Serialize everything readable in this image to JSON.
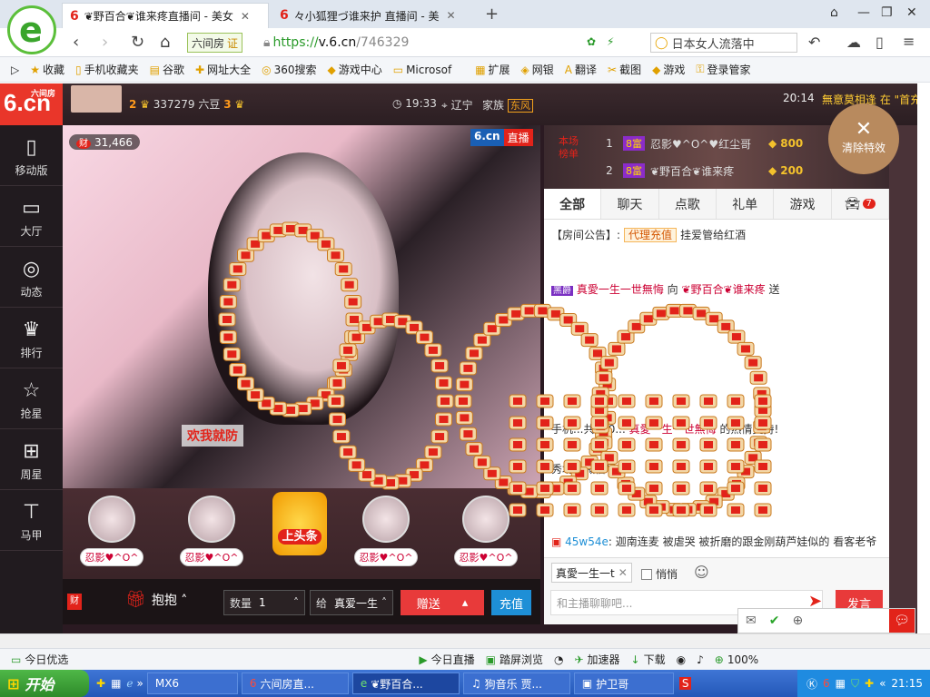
{
  "browser": {
    "tabs": [
      {
        "title": "❦野百合❦谁来疼直播间 - 美女",
        "active": true
      },
      {
        "title": "々小狐狸づ谁来护  直播间 - 美",
        "active": false
      }
    ],
    "new_tab": "+",
    "site_chip": "六间房",
    "site_cert": "证",
    "url_scheme": "https://",
    "url_host": "v.6.cn",
    "url_path": "/746329",
    "search_text": "日本女人流落中",
    "bookmarks": [
      "收藏",
      "手机收藏夹",
      "谷歌",
      "网址大全",
      "360搜索",
      "游戏中心",
      "Microsof",
      "扩展",
      "网银",
      "翻译",
      "截图",
      "游戏",
      "登录管家"
    ]
  },
  "site": {
    "brand": "6.cn",
    "brand_small": "六间房",
    "nav": [
      {
        "label": "移动版",
        "icon": "phone-icon"
      },
      {
        "label": "大厅",
        "icon": "tv-icon"
      },
      {
        "label": "动态",
        "icon": "compass-icon"
      },
      {
        "label": "排行",
        "icon": "crown-icon"
      },
      {
        "label": "抢星",
        "icon": "star-icon"
      },
      {
        "label": "周星",
        "icon": "gift-icon"
      },
      {
        "label": "马甲",
        "icon": "shirt-icon"
      }
    ]
  },
  "room": {
    "level_left": "2",
    "fans": "337279 六豆",
    "level_right": "3",
    "time": "19:33",
    "location": "辽宁",
    "family_label": "家族",
    "family_tag": "东风",
    "clock": "20:14",
    "marquee": "無意莫相逢 在 \"首充",
    "viewers": "31,466",
    "viewer_badge": "财",
    "watermark": "6.cn",
    "live_tag": "直播",
    "banner": "欢我就防"
  },
  "gifts_row": [
    {
      "name": "忍影♥^O^"
    },
    {
      "name": "忍影♥^O^"
    },
    {
      "name": "上头条"
    },
    {
      "name": "忍影♥^O^"
    },
    {
      "name": "忍影♥^O^"
    }
  ],
  "controls": {
    "cai": "财",
    "hug": "抱抱",
    "qty_label": "数量",
    "qty_value": "1",
    "to_label": "给",
    "to_value": "真爱一生",
    "send": "赠送",
    "recharge": "充值"
  },
  "rank": {
    "label": "本场榜单",
    "entries": [
      {
        "no": "1",
        "level": "8富",
        "nick": "忍影♥^O^♥红尘哥",
        "amount": "800"
      },
      {
        "no": "2",
        "level": "8富",
        "nick": "❦野百合❦谁来疼",
        "amount": "200"
      }
    ],
    "clear_fx": "清除特效",
    "guard": "守"
  },
  "chat": {
    "tabs": [
      {
        "label": "全部",
        "active": true
      },
      {
        "label": "聊天"
      },
      {
        "label": "点歌"
      },
      {
        "label": "礼单"
      },
      {
        "label": "游戏"
      },
      {
        "label": "",
        "badge": "7"
      }
    ],
    "notice_prefix": "【房间公告】:",
    "notice_tag": "代理充值",
    "notice_text": "挂爱管给红酒",
    "messages": [
      {
        "vip": "黑爵",
        "nick": "真愛一生一世無悔",
        "mid": "向",
        "target": "❦野百合❦谁来疼",
        "tail": "送"
      },
      {
        "text": "手机...共100...",
        "nick": "真愛一生一世無悔",
        "tail": "的热情支持!"
      },
      {
        "text": "秀场】微信号"
      },
      {
        "nick": "45w54e",
        "tail": ": 迦南连麦 被虐哭 被折磨的跟金刚葫芦娃似的 看客老爷"
      }
    ],
    "target": "真愛一生一t",
    "whisper": "悄悄",
    "placeholder": "和主播聊聊吧...",
    "send": "发言"
  },
  "statusbar": {
    "items": [
      "今日优选",
      "今日直播",
      "踏屏浏览",
      "加速器",
      "下载",
      "100%"
    ]
  },
  "taskbar": {
    "start": "开始",
    "items": [
      {
        "label": "MX6"
      },
      {
        "label": "六间房直..."
      },
      {
        "label": "❦野百合...",
        "active": true
      },
      {
        "label": "狗音乐 贾..."
      },
      {
        "label": "护卫哥"
      }
    ],
    "clock": "21:15"
  }
}
